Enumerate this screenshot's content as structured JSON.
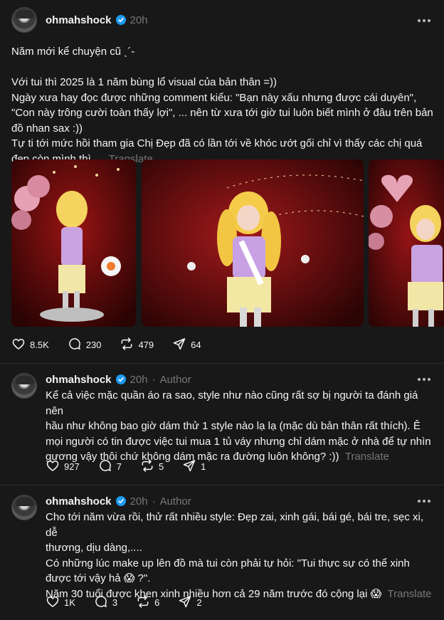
{
  "posts": [
    {
      "username": "ohmahshock",
      "time": "20h",
      "author_tag": "",
      "text_lines": [
        "Năm mới kể chuyện cũ ˎ´-",
        "",
        "Với tui thì 2025 là 1 năm bùng lổ visual của bản thân =))",
        "Ngày xưa hay đọc được những comment kiểu: \"Bạn này xấu nhưng được cái duyên\",",
        "\"Con này trông cười toàn thấy lợi\", ... nên từ xưa tới giờ tui luôn biết mình ở đâu trên bản",
        "đồ nhan sax :))",
        "Tự ti tới mức hồi tham gia Chị Đẹp đã có lần tới về khóc ướt gối chỉ vì thấy các chị quá",
        "đẹp còn mình thì ..."
      ],
      "translate_label": "Translate",
      "likes": "8.5K",
      "replies": "230",
      "reposts": "479",
      "shares": "64"
    },
    {
      "username": "ohmahshock",
      "time": "20h",
      "author_tag": "Author",
      "text_lines": [
        "Kể cả việc mặc quần áo ra sao, style như nào cũng rất sợ bị người ta đánh giá nên",
        "hầu như không bao giờ dám thử 1 style nào lạ lạ (mặc dù bản thân rất thích). Ê",
        "mọi người có tin được việc tui mua 1 tủ váy nhưng chỉ dám mặc ở nhà để tự nhìn",
        "gương vậy thôi chứ không dám mặc ra đường luôn không? :))"
      ],
      "translate_label": "Translate",
      "likes": "927",
      "replies": "7",
      "reposts": "5",
      "shares": "1"
    },
    {
      "username": "ohmahshock",
      "time": "20h",
      "author_tag": "Author",
      "text_lines": [
        "Cho tới năm vừa rồi, thử rất nhiều style: Đẹp zai, xinh gái, bái gé, bái tre, sẹc xi, dễ",
        "thương, dịu dàng,....",
        "Có những lúc make up lên đồ mà tui còn phải tự hỏi: \"Tui thực sự có thể xinh",
        "được tới vậy hả 😱 ?\".",
        "Năm 30 tuổi được khen xinh nhiều hơn cả 29 năm trước đó cộng lại 😱"
      ],
      "translate_label": "Translate",
      "likes": "1K",
      "replies": "3",
      "reposts": "6",
      "shares": "2"
    }
  ],
  "icons": {
    "verified": "verified-badge-icon",
    "more": "more-options-icon",
    "like": "heart-icon",
    "reply": "comment-icon",
    "repost": "repost-icon",
    "share": "share-icon"
  },
  "colors": {
    "background": "#181818",
    "text": "#f3f5f7",
    "muted": "#777777",
    "verified": "#1d9bf0",
    "divider": "#2d2d2d"
  }
}
